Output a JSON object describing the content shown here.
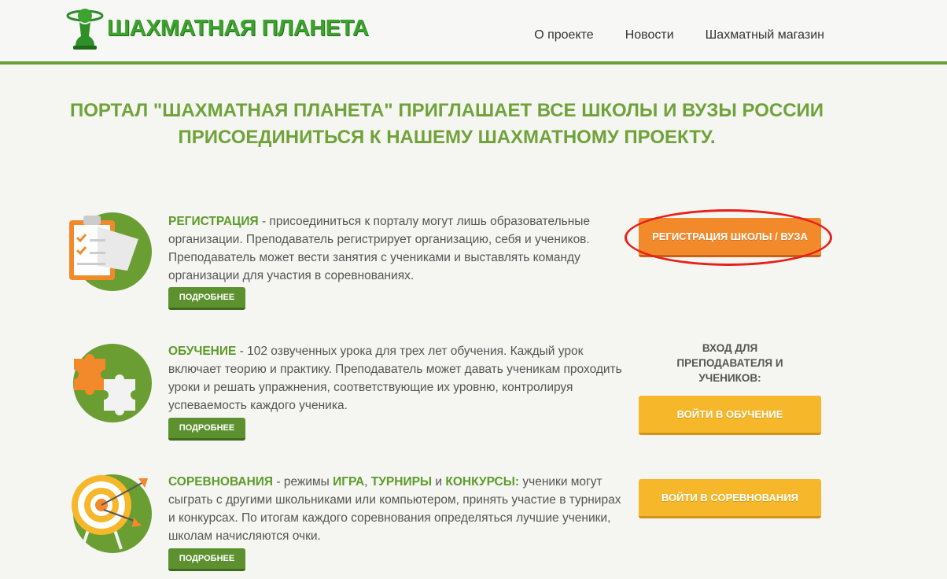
{
  "brand": {
    "name": "ШАХМАТНАЯ ПЛАНЕТА"
  },
  "nav": {
    "items": [
      "О проекте",
      "Новости",
      "Шахматный магазин"
    ]
  },
  "headline": {
    "line1": "ПОРТАЛ \"ШАХМАТНАЯ ПЛАНЕТА\" ПРИГЛАШАЕТ ВСЕ ШКОЛЫ И ВУЗЫ РОССИИ",
    "line2": "ПРИСОЕДИНИТЬСЯ К НАШЕМУ ШАХМАТНОМУ ПРОЕКТУ."
  },
  "sections": {
    "registration": {
      "title": "РЕГИСТРАЦИЯ",
      "text": " - присоединиться к порталу могут лишь образовательные организации. Преподаватель регистрирует организацию, себя и учеников. Преподаватель может вести занятия с учениками и выставлять команду организации для участия в соревнованиях.",
      "more": "ПОДРОБНЕЕ",
      "button": "РЕГИСТРАЦИЯ ШКОЛЫ / ВУЗА"
    },
    "learning": {
      "title": "ОБУЧЕНИЕ",
      "text": " - 102 озвученных урока для трех лет обучения. Каждый урок включает теорию и практику. Преподаватель может давать ученикам проходить уроки и решать упражнения, соответствующие их уровню, контролируя успеваемость каждого ученика.",
      "more": "ПОДРОБНЕЕ",
      "login_label": "ВХОД ДЛЯ ПРЕПОДАВАТЕЛЯ И УЧЕНИКОВ:",
      "button": "ВОЙТИ В ОБУЧЕНИЕ"
    },
    "competitions": {
      "title": "СОРЕВНОВАНИЯ",
      "text_a": " - режимы ",
      "game": "ИГРА",
      "comma": ", ",
      "tournaments": "ТУРНИРЫ",
      "and": " и ",
      "contests": "КОНКУРСЫ:",
      "text_b": " ученики могут сыграть с другими школьниками или компьютером, принять участие в турнирах и конкурсах. По итогам каждого соревнования определяться лучшие ученики, школам начисляются очки.",
      "more": "ПОДРОБНЕЕ",
      "button": "ВОЙТИ В СОРЕВНОВАНИЯ"
    }
  },
  "colors": {
    "green": "#6b9e32",
    "orange": "#f28a2c",
    "yellow": "#f6b82a",
    "highlight_red": "#e8201a"
  }
}
